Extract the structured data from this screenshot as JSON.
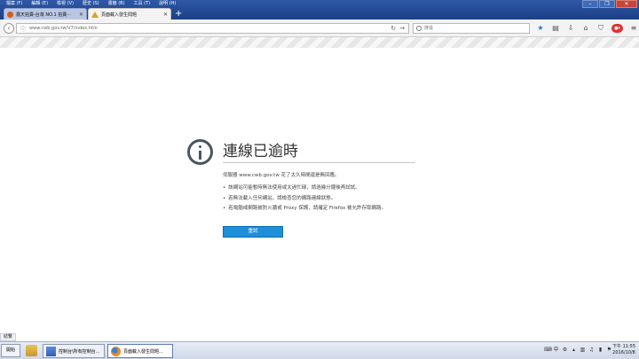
{
  "menu": [
    {
      "label": "檔案 (F)"
    },
    {
      "label": "編輯 (E)"
    },
    {
      "label": "檢視 (V)"
    },
    {
      "label": "歷史 (S)"
    },
    {
      "label": "書籤 (B)"
    },
    {
      "label": "工具 (T)"
    },
    {
      "label": "說明 (H)"
    }
  ],
  "tabs": [
    {
      "label": "露天拍賣-台灣 NO.1 拍賣⋯"
    },
    {
      "label": "頁面載入發生問題"
    }
  ],
  "nav": {
    "url": "www.cwb.gov.tw/V7/index.htm",
    "search_placeholder": "搜尋"
  },
  "error": {
    "title": "連線已逾時",
    "description": "伺服器 www.cwb.gov.tw 花了太久時間還是無回應。",
    "bullets": [
      "該網站可能暫時無法使用或太過忙碌，請過幾分鐘後再試試。",
      "若無法載入任何網站，請檢查您的網路連線狀態。",
      "若電腦或網路被防火牆或 Proxy 保護，請確定 Firefox 被允許存取網路。"
    ],
    "retry_label": "重試"
  },
  "status_text": "結繫",
  "taskbar": {
    "start_label": "開始",
    "tasks": [
      {
        "label": "控制台\\所有控制台..."
      },
      {
        "label": "頁面載入發生問題..."
      }
    ],
    "clock_time": "下午 11:55",
    "clock_date": "2016/10/8"
  },
  "colors": {
    "title_bar": "#1c3f86",
    "retry_button": "#1f8fd9",
    "error_icon": "#4a5563"
  }
}
